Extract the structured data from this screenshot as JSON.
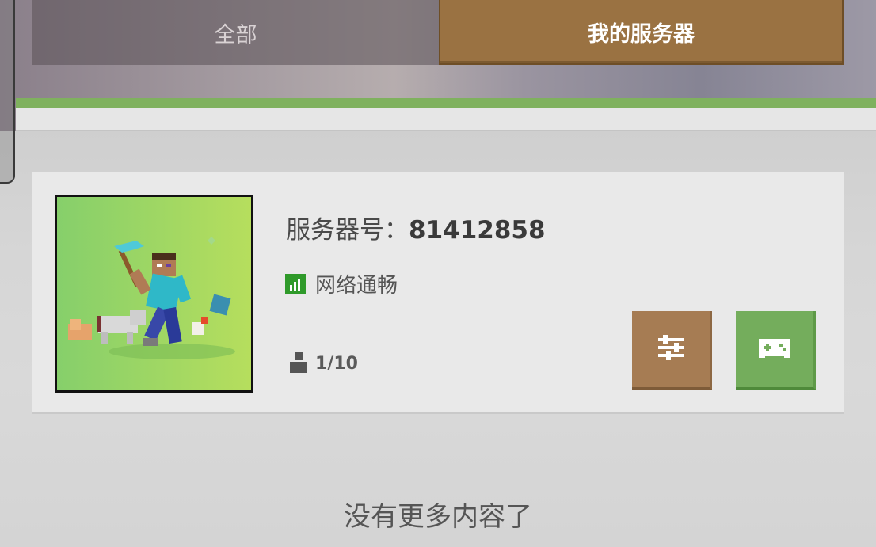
{
  "tabs": {
    "all_label": "全部",
    "mine_label": "我的服务器"
  },
  "server": {
    "id_label": "服务器号：",
    "id_value": "81412858",
    "network_status": "网络通畅",
    "players": "1/10"
  },
  "footer": {
    "no_more_text": "没有更多内容了"
  },
  "icons": {
    "signal": "signal-bars-icon",
    "player": "player-icon",
    "settings": "sliders-icon",
    "play": "gamepad-icon"
  },
  "colors": {
    "tab_active": "#9a7242",
    "settings_button": "#a67c53",
    "play_button": "#74ad5c",
    "signal_good": "#2f9a2a"
  }
}
